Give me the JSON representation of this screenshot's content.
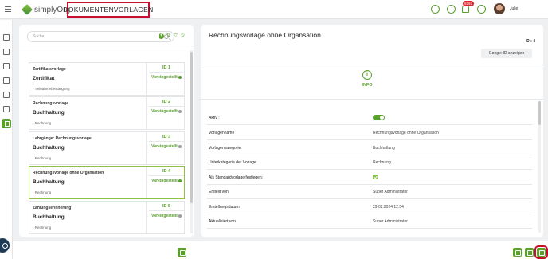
{
  "app": {
    "brand": "simplyOrg",
    "page_title": "DOKUMENTENVORLAGEN",
    "notification_count": "9292",
    "user_name": "Julie"
  },
  "list": {
    "search_placeholder": "Suche",
    "items": [
      {
        "name": "Zertifikatsvorlage",
        "category": "Zertifikat",
        "sub": "- Teilnahmebestätigung",
        "id": "ID 1",
        "state": "Voreingestellt",
        "state_color": "#5aa02c",
        "selected": false
      },
      {
        "name": "Rechnungsvorlage",
        "category": "Buchhaltung",
        "sub": "- Rechnung",
        "id": "ID 2",
        "state": "Voreingestellt",
        "state_color": "#9e9e9e",
        "selected": false
      },
      {
        "name": "Lehrgänge: Rechnungsvorlage",
        "category": "Buchhaltung",
        "sub": "- Rechnung",
        "id": "ID 3",
        "state": "Voreingestellt",
        "state_color": "#9e9e9e",
        "selected": false
      },
      {
        "name": "Rechnungsvorlage ohne Organsation",
        "category": "Buchhaltung",
        "sub": "- Rechnung",
        "id": "ID 4",
        "state": "Voreingestellt",
        "state_color": "#5aa02c",
        "selected": true
      },
      {
        "name": "Zahlungserinnerung",
        "category": "Buchhaltung",
        "sub": "- Rechnung",
        "id": "ID 5",
        "state": "Voreingestellt",
        "state_color": "#9e9e9e",
        "selected": false
      }
    ]
  },
  "detail": {
    "title": "Rechnungsvorlage ohne Organsation",
    "id_label": "ID : 4",
    "google_button": "Google-ID anzeigen",
    "info_label": "INFO",
    "rows": [
      {
        "label": "Aktiv :",
        "value": "",
        "kind": "toggle"
      },
      {
        "label": "Vorlagenname",
        "value": "Rechnungsvorlage ohne Organsation",
        "kind": "text"
      },
      {
        "label": "Vorlagenkategorie",
        "value": "Buchhaltung",
        "kind": "text"
      },
      {
        "label": "Unterkategorie der Vorlage",
        "value": "Rechnung",
        "kind": "text"
      },
      {
        "label": "Als Standardvorlage festlegen:",
        "value": "",
        "kind": "check"
      },
      {
        "label": "Erstellt von",
        "value": "Super Administrator",
        "kind": "text"
      },
      {
        "label": "Erstellungsdatum",
        "value": "29.02.2024 12:54",
        "kind": "text"
      },
      {
        "label": "Aktualisiert von",
        "value": "Super Administrator",
        "kind": "text"
      }
    ]
  },
  "icons": {
    "top": [
      "lightbulb-icon",
      "clock-icon",
      "bell-icon",
      "help-icon"
    ],
    "rail": [
      "grid-icon",
      "book-icon",
      "building-icon",
      "list-icon",
      "megaphone-icon",
      "frame-icon",
      "document-icon"
    ],
    "footer": [
      "copy-icon",
      "edit-icon",
      "delete-icon",
      "google-icon"
    ]
  },
  "colors": {
    "accent": "#5aa02c",
    "highlight": "#c8102e"
  }
}
